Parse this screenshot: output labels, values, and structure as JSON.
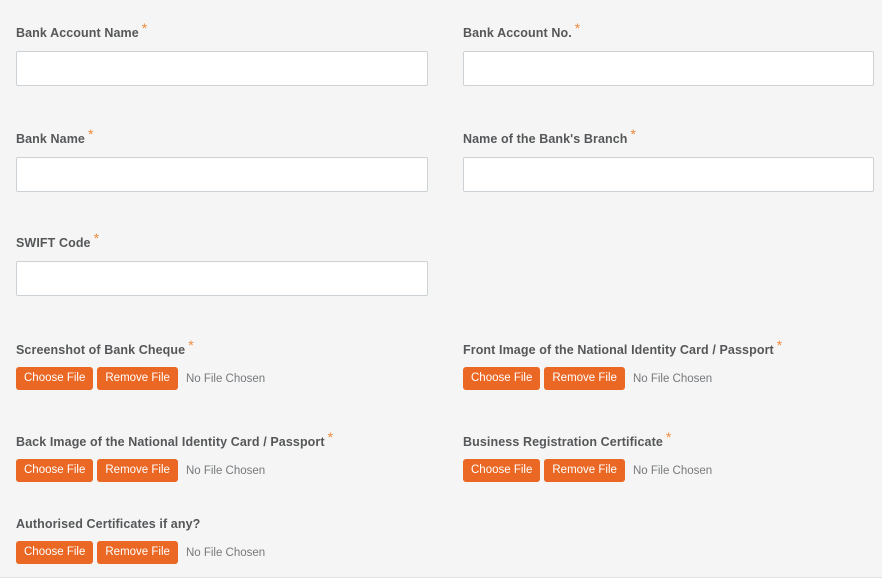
{
  "theme": {
    "page_background": "#f5f5f5",
    "button_color": "#ea6724",
    "required_star_color": "#f08a3c",
    "label_color": "#555759",
    "input_border": "#ccd1d6"
  },
  "required_marker": "*",
  "rows": [
    {
      "left": {
        "label": "Bank Account Name",
        "required": true,
        "type": "text",
        "value": "",
        "placeholder": ""
      },
      "right": {
        "label": "Bank Account No.",
        "required": true,
        "type": "text",
        "value": "",
        "placeholder": ""
      }
    },
    {
      "left": {
        "label": "Bank Name",
        "required": true,
        "type": "text",
        "value": "",
        "placeholder": ""
      },
      "right": {
        "label": "Name of the Bank's Branch",
        "required": true,
        "type": "text",
        "value": "",
        "placeholder": ""
      }
    },
    {
      "left": {
        "label": "SWIFT Code",
        "required": true,
        "type": "text",
        "value": "",
        "placeholder": ""
      },
      "right": null
    },
    {
      "left": {
        "label": "Screenshot of Bank Cheque",
        "required": true,
        "type": "file",
        "choose_label": "Choose File",
        "remove_label": "Remove File",
        "status": "No File Chosen"
      },
      "right": {
        "label": "Front Image of the National Identity Card / Passport",
        "required": true,
        "type": "file",
        "choose_label": "Choose File",
        "remove_label": "Remove File",
        "status": "No File Chosen"
      }
    },
    {
      "left": {
        "label": "Back Image of the National Identity Card / Passport",
        "required": true,
        "type": "file",
        "choose_label": "Choose File",
        "remove_label": "Remove File",
        "status": "No File Chosen"
      },
      "right": {
        "label": "Business Registration Certificate",
        "required": true,
        "type": "file",
        "choose_label": "Choose File",
        "remove_label": "Remove File",
        "status": "No File Chosen"
      }
    },
    {
      "left": {
        "label": "Authorised Certificates if any?",
        "required": false,
        "type": "file",
        "choose_label": "Choose File",
        "remove_label": "Remove File",
        "status": "No File Chosen"
      },
      "right": null
    }
  ]
}
